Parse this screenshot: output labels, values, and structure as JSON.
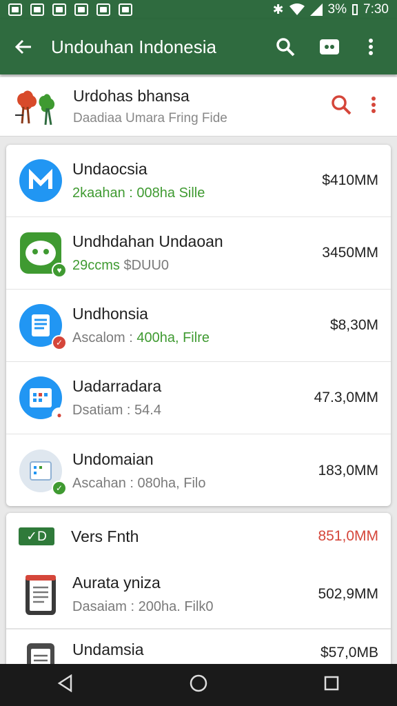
{
  "status_bar": {
    "battery": "3%",
    "time": "7:30"
  },
  "app_bar": {
    "title": "Undouhan Indonesia"
  },
  "promo": {
    "title": "Urdohas bhansa",
    "subtitle": "Daadiaa Umara Fring Fide"
  },
  "list": [
    {
      "name": "Undaocsia",
      "sub_prefix": "",
      "sub_highlight": "2kaahan : 008ha Sille",
      "size": "$410MM"
    },
    {
      "name": "Undhdahan Undaoan",
      "sub_prefix": "",
      "sub_highlight": "29ccms",
      "sub_rest": " $DUU0",
      "size": "3450MM"
    },
    {
      "name": "Undhonsia",
      "sub_prefix": "Ascalom : ",
      "sub_highlight": "400ha, Filre",
      "size": "$8,30M"
    },
    {
      "name": "Uadarradara",
      "sub_prefix": "Dsatiam : 54.4",
      "sub_highlight": "",
      "size": "47.3,0MM"
    },
    {
      "name": "Undomaian",
      "sub_prefix": "Ascahan : 080ha, Filo",
      "sub_highlight": "",
      "size": "183,0MM"
    }
  ],
  "section": {
    "badge": "✓D",
    "title": "Vers Fnth",
    "size": "851,0MM"
  },
  "list2": [
    {
      "name": "Aurata ynіza",
      "sub": "Dasaiam : 200ha. Filk0",
      "size": "502,9MM"
    },
    {
      "name": "Undamsia",
      "sub": "",
      "size": "$57,0MB"
    }
  ]
}
